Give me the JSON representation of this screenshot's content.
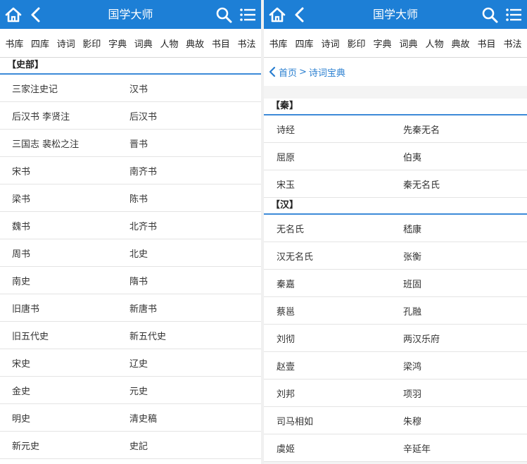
{
  "app": {
    "title": "国学大师"
  },
  "nav_items": [
    "书库",
    "四库",
    "诗词",
    "影印",
    "字典",
    "词典",
    "人物",
    "典故",
    "书目",
    "书法"
  ],
  "left_panel": {
    "section_title": "【史部】",
    "rows": [
      [
        "三家注史记",
        "汉书"
      ],
      [
        "后汉书 李贤注",
        "后汉书"
      ],
      [
        "三国志 裴松之注",
        "晋书"
      ],
      [
        "宋书",
        "南齐书"
      ],
      [
        "梁书",
        "陈书"
      ],
      [
        "魏书",
        "北齐书"
      ],
      [
        "周书",
        "北史"
      ],
      [
        "南史",
        "隋书"
      ],
      [
        "旧唐书",
        "新唐书"
      ],
      [
        "旧五代史",
        "新五代史"
      ],
      [
        "宋史",
        "辽史"
      ],
      [
        "金史",
        "元史"
      ],
      [
        "明史",
        "清史稿"
      ],
      [
        "新元史",
        "史記"
      ]
    ]
  },
  "right_panel": {
    "breadcrumb": {
      "home": "首页",
      "separator": ">",
      "current": "诗词宝典"
    },
    "sections": [
      {
        "title": "【秦】",
        "rows": [
          [
            "诗经",
            "先秦无名"
          ],
          [
            "屈原",
            "伯夷"
          ],
          [
            "宋玉",
            "秦无名氏"
          ]
        ]
      },
      {
        "title": "【汉】",
        "rows": [
          [
            "无名氏",
            "嵇康"
          ],
          [
            "汉无名氏",
            "张衡"
          ],
          [
            "秦嘉",
            "班固"
          ],
          [
            "蔡邕",
            "孔融"
          ],
          [
            "刘彻",
            "两汉乐府"
          ],
          [
            "赵壹",
            "梁鸿"
          ],
          [
            "刘邦",
            "项羽"
          ],
          [
            "司马相如",
            "朱穆"
          ],
          [
            "虞姬",
            "辛延年"
          ]
        ]
      }
    ]
  },
  "icons": {
    "home": "home-icon",
    "back": "back-icon",
    "search": "search-icon",
    "menu": "menu-icon"
  },
  "colors": {
    "topbar": "#1d7fd6",
    "accent": "#3d8ad8",
    "link": "#2a7fd0"
  }
}
